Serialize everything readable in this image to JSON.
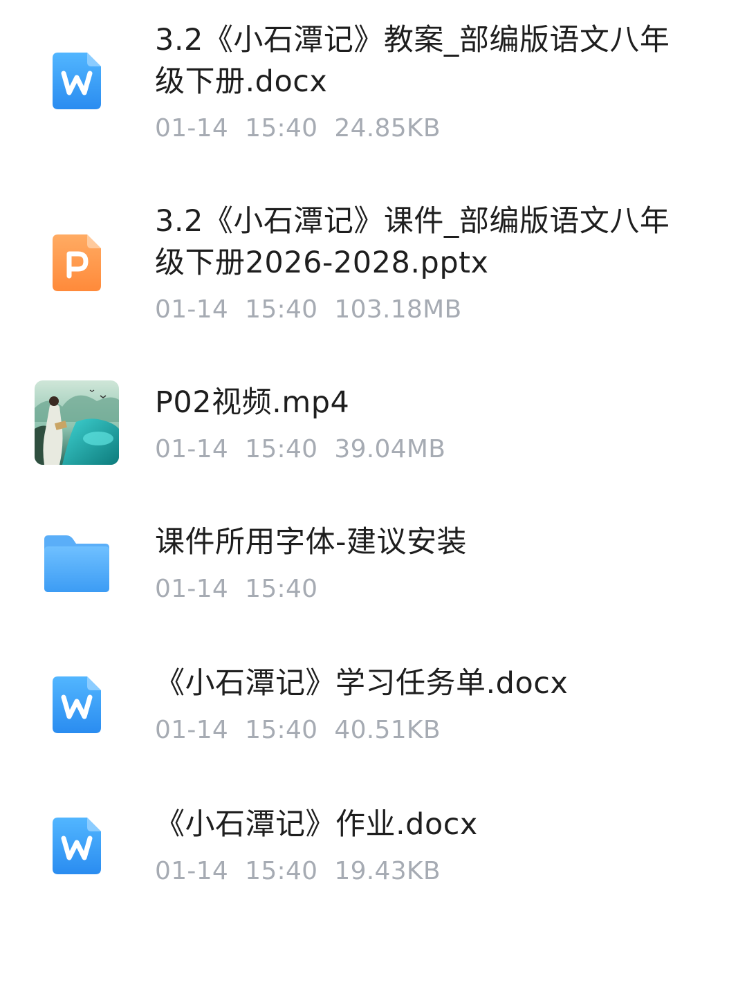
{
  "files": [
    {
      "type": "docx",
      "icon": "word-doc-icon",
      "name": "3.2《小石潭记》教案_部编版语文八年级下册.docx",
      "date": "01-14",
      "time": "15:40",
      "size": "24.85KB"
    },
    {
      "type": "pptx",
      "icon": "powerpoint-icon",
      "name": "3.2《小石潭记》课件_部编版语文八年级下册2026-2028.pptx",
      "date": "01-14",
      "time": "15:40",
      "size": "103.18MB"
    },
    {
      "type": "mp4",
      "icon": "video-thumbnail",
      "name": "P02视频.mp4",
      "date": "01-14",
      "time": "15:40",
      "size": "39.04MB"
    },
    {
      "type": "folder",
      "icon": "folder-icon",
      "name": "课件所用字体-建议安装",
      "date": "01-14",
      "time": "15:40",
      "size": ""
    },
    {
      "type": "docx",
      "icon": "word-doc-icon",
      "name": "《小石潭记》学习任务单.docx",
      "date": "01-14",
      "time": "15:40",
      "size": "40.51KB"
    },
    {
      "type": "docx",
      "icon": "word-doc-icon",
      "name": "《小石潭记》作业.docx",
      "date": "01-14",
      "time": "15:40",
      "size": "19.43KB"
    }
  ],
  "colors": {
    "word_top": "#52b6ff",
    "word_bottom": "#2a8cf0",
    "ppt_top": "#ffab63",
    "ppt_bottom": "#ff8a3a",
    "folder_top": "#6fc0ff",
    "folder_bottom": "#3c9cf4",
    "meta_text": "#a6abb3",
    "name_text": "#1e1e1e"
  }
}
